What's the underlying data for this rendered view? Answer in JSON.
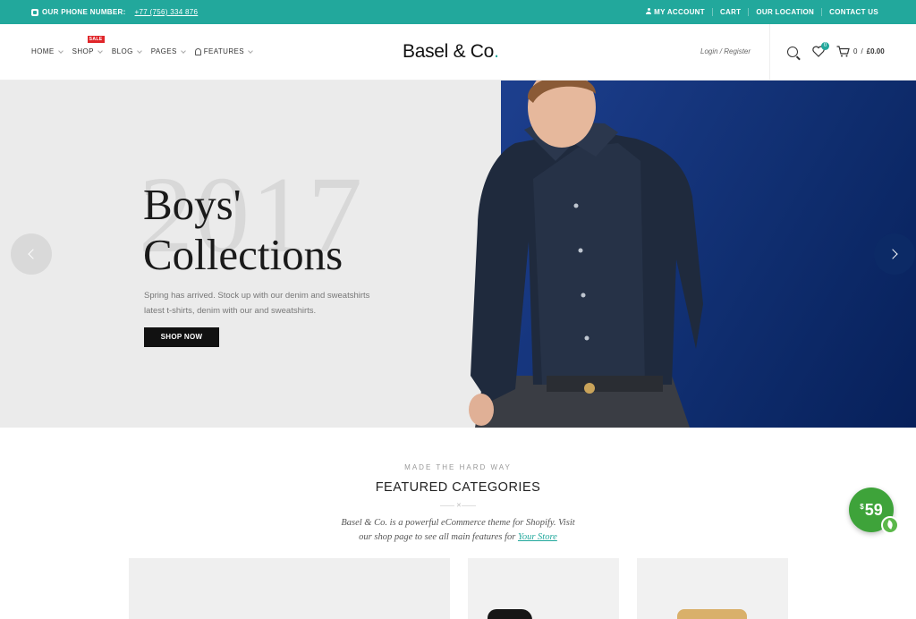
{
  "topbar": {
    "phone_label": "OUR PHONE NUMBER:",
    "phone_number": "+77 (756) 334 876",
    "links": [
      "MY ACCOUNT",
      "CART",
      "OUR LOCATION",
      "CONTACT US"
    ],
    "bg_color": "#22a89c"
  },
  "header": {
    "nav": [
      {
        "label": "HOME"
      },
      {
        "label": "SHOP",
        "badge": "SALE"
      },
      {
        "label": "BLOG"
      },
      {
        "label": "PAGES"
      },
      {
        "label": "FEATURES"
      }
    ],
    "logo": "Basel & Co",
    "logo_dot": ".",
    "login": "Login / Register",
    "wishlist_count": "0",
    "cart_count": "0",
    "cart_separator": "/",
    "cart_total": "£0.00"
  },
  "hero": {
    "bg_text": "2017",
    "title_line1": "Boys'",
    "title_line2": "Collections",
    "desc_line1": "Spring has arrived. Stock up with our denim and sweatshirts",
    "desc_line2": "latest t-shirts, denim with our and sweatshirts.",
    "button": "SHOP NOW"
  },
  "featured": {
    "subtitle": "MADE THE HARD WAY",
    "title": "FEATURED CATEGORIES",
    "desc_line1": "Basel & Co. is a powerful eCommerce theme for Shopify. Visit",
    "desc_line2_prefix": "our shop page to see all main features for",
    "desc_link": "Your Store"
  },
  "price_badge": {
    "currency": "$",
    "amount": "59"
  },
  "icons": {
    "phone": "phone-icon",
    "user": "user-icon",
    "bell": "bell-icon",
    "search": "search-icon",
    "heart": "heart-icon",
    "cart": "cart-icon",
    "prev": "chevron-left-icon",
    "next": "chevron-right-icon"
  }
}
